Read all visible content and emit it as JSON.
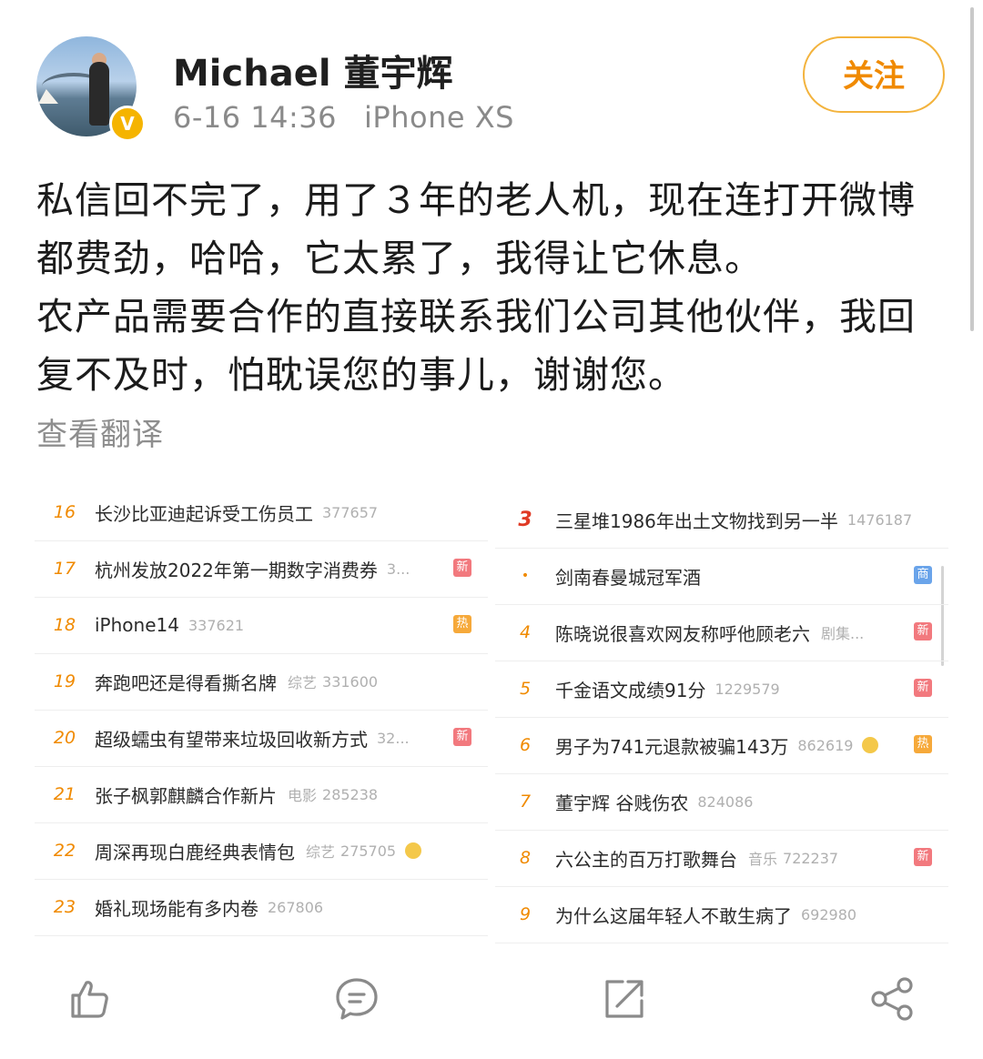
{
  "header": {
    "username": "Michael 董宇辉",
    "date": "6-16 14:36",
    "device": "iPhone XS",
    "verified_badge": "V",
    "follow_label": "关注"
  },
  "post": {
    "paragraphs": [
      "私信回不完了，用了３年的老人机，现在连打开微博都费劲，哈哈，它太累了，我得让它休息。",
      "农产品需要合作的直接联系我们公司其他伙伴，我回复不及时，怕耽误您的事儿，谢谢您。"
    ],
    "translate_label": "查看翻译"
  },
  "hot_left": [
    {
      "rank": "16",
      "title": "长沙比亚迪起诉受工伤员工",
      "category": "",
      "heat": "377657",
      "badge": ""
    },
    {
      "rank": "17",
      "title": "杭州发放2022年第一期数字消费券",
      "category": "",
      "heat": "3...",
      "badge": "新"
    },
    {
      "rank": "18",
      "title": "iPhone14",
      "category": "",
      "heat": "337621",
      "badge": "热"
    },
    {
      "rank": "19",
      "title": "奔跑吧还是得看撕名牌",
      "category": "综艺",
      "heat": "331600",
      "badge": ""
    },
    {
      "rank": "20",
      "title": "超级蠕虫有望带来垃圾回收新方式",
      "category": "",
      "heat": "32...",
      "badge": "新"
    },
    {
      "rank": "21",
      "title": "张子枫郭麒麟合作新片",
      "category": "电影",
      "heat": "285238",
      "badge": ""
    },
    {
      "rank": "22",
      "title": "周深再现白鹿经典表情包",
      "category": "综艺",
      "heat": "275705",
      "badge": ""
    },
    {
      "rank": "23",
      "title": "婚礼现场能有多内卷",
      "category": "",
      "heat": "267806",
      "badge": ""
    }
  ],
  "hot_right": [
    {
      "rank": "3",
      "title": "三星堆1986年出土文物找到另一半",
      "category": "",
      "heat": "1476187",
      "badge": ""
    },
    {
      "rank": "•",
      "title": "剑南春曼城冠军酒",
      "category": "",
      "heat": "",
      "badge": "商"
    },
    {
      "rank": "4",
      "title": "陈晓说很喜欢网友称呼他顾老六",
      "category": "剧集...",
      "heat": "",
      "badge": "新"
    },
    {
      "rank": "5",
      "title": "千金语文成绩91分",
      "category": "",
      "heat": "1229579",
      "badge": "新"
    },
    {
      "rank": "6",
      "title": "男子为741元退款被骗143万",
      "category": "",
      "heat": "862619",
      "badge": "热"
    },
    {
      "rank": "7",
      "title": "董宇辉 谷贱伤农",
      "category": "",
      "heat": "824086",
      "badge": ""
    },
    {
      "rank": "8",
      "title": "六公主的百万打歌舞台",
      "category": "音乐",
      "heat": "722237",
      "badge": "新"
    },
    {
      "rank": "9",
      "title": "为什么这届年轻人不敢生病了",
      "category": "",
      "heat": "692980",
      "badge": ""
    }
  ],
  "toolbar": {
    "icons": [
      "like-icon",
      "comment-icon",
      "repost-icon",
      "share-icon"
    ]
  },
  "colors": {
    "accent": "#f08a00",
    "follow_border": "#f3b33d",
    "verified": "#f5b400",
    "top_rank": "#e03a25",
    "badge_new": "#f2797e",
    "badge_hot": "#f6a93a",
    "badge_biz": "#6aa4ea"
  }
}
